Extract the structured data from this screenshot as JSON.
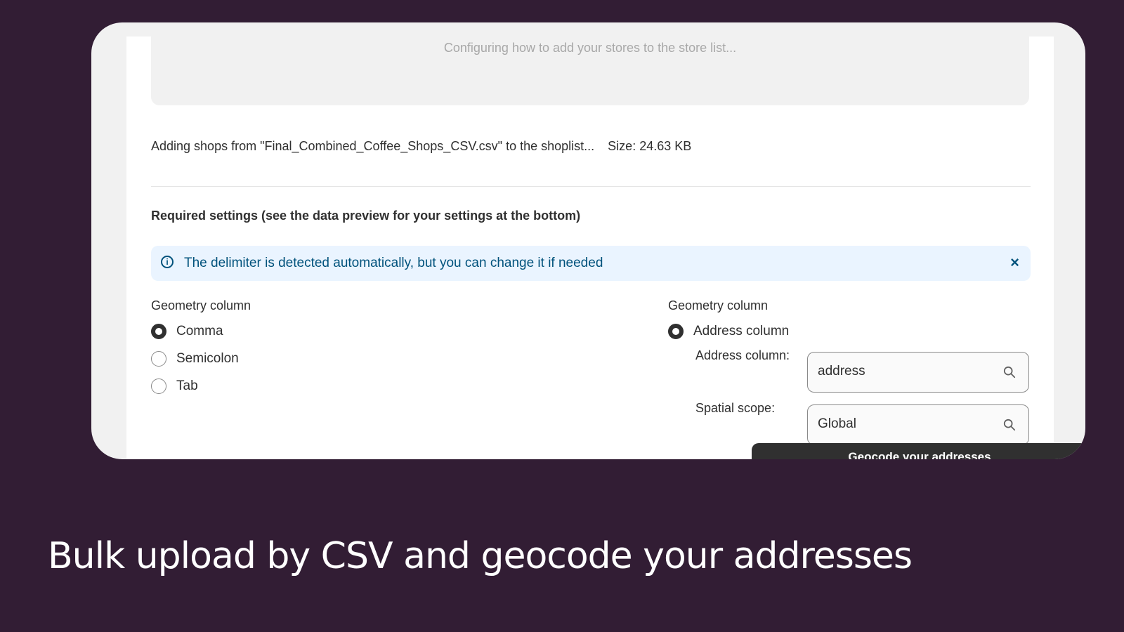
{
  "dropzone": {
    "status_text": "Configuring how to add your stores to the store list..."
  },
  "file_info": {
    "adding_text": "Adding shops from \"Final_Combined_Coffee_Shops_CSV.csv\" to the shoplist...",
    "size_text": "Size: 24.63 KB"
  },
  "required_settings": {
    "title": "Required settings (see the data preview for your settings at the bottom)"
  },
  "banner": {
    "message": "The delimiter is detected automatically, but you can change it if needed",
    "close_glyph": "×",
    "info_glyph": "i"
  },
  "delimiter": {
    "label": "Geometry column",
    "options": [
      "Comma",
      "Semicolon",
      "Tab"
    ],
    "selected": "Comma"
  },
  "geometry": {
    "label": "Geometry column",
    "option": "Address column",
    "address_label": "Address column:",
    "address_value": "address",
    "scope_label": "Spatial scope:",
    "scope_value": "Global",
    "button_label": "Geocode your addresses"
  },
  "caption": "Bulk upload by CSV and geocode your addresses",
  "colors": {
    "background": "#321d34",
    "banner": "#eaf4ff",
    "banner_text": "#00527c",
    "button": "#303030"
  }
}
